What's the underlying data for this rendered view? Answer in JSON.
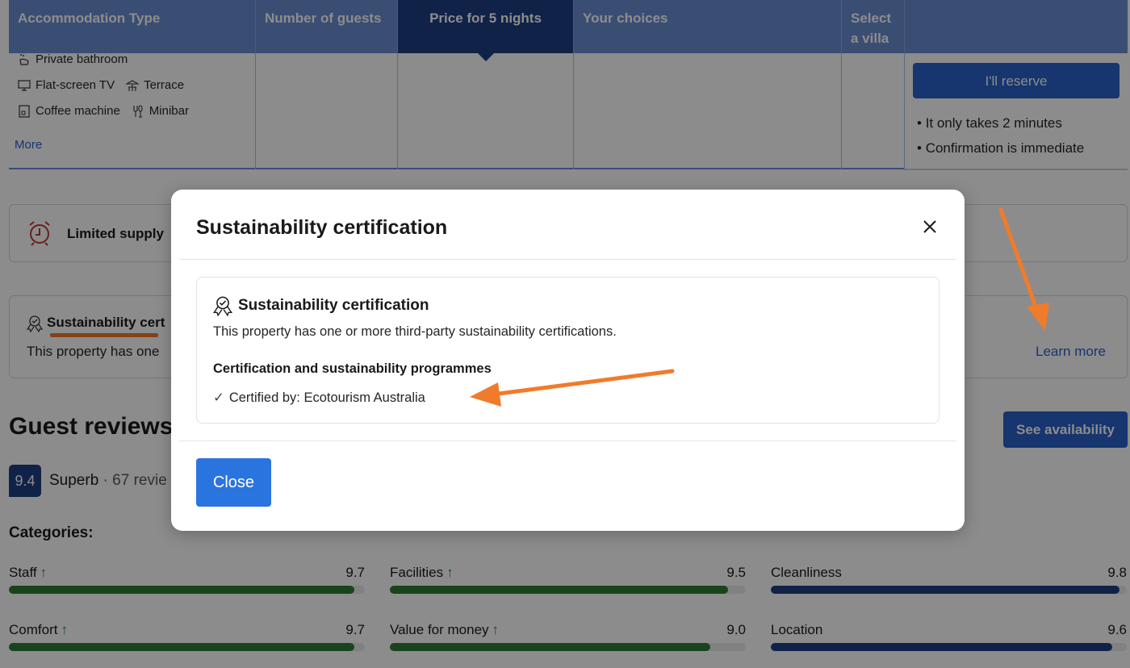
{
  "table": {
    "headers": [
      {
        "label": "Accommodation Type"
      },
      {
        "label": "Number of guests"
      },
      {
        "label": "Price for 5 nights"
      },
      {
        "label": "Your choices"
      },
      {
        "label": "Select a villa"
      },
      {
        "label": ""
      }
    ],
    "amenities": [
      {
        "label": "Private bathroom",
        "icon": "bathroom-icon"
      },
      {
        "label": "Flat-screen TV",
        "icon": "tv-icon"
      },
      {
        "label": "Terrace",
        "icon": "terrace-icon"
      },
      {
        "label": "Coffee machine",
        "icon": "coffee-machine-icon"
      },
      {
        "label": "Minibar",
        "icon": "minibar-icon"
      }
    ],
    "more_link": "More",
    "reserve_button": "I'll reserve",
    "reserve_notes": [
      "It only takes 2 minutes",
      "Confirmation is immediate"
    ]
  },
  "limited_supply": {
    "label": "Limited supply"
  },
  "sustainability_box": {
    "title": "Sustainability cert",
    "description": "This property has one",
    "learn_more": "Learn more"
  },
  "reviews": {
    "title": "Guest reviews",
    "see_availability": "See availability",
    "score": "9.4",
    "rating_label": "Superb",
    "separator": " · ",
    "review_count": "67 revie",
    "categories_title": "Categories:",
    "categories": [
      {
        "name": "Staff",
        "score": 9.7,
        "score_text": "9.7",
        "trend_up": true,
        "color": "#2e7a36"
      },
      {
        "name": "Facilities",
        "score": 9.5,
        "score_text": "9.5",
        "trend_up": true,
        "color": "#2e7a36"
      },
      {
        "name": "Cleanliness",
        "score": 9.8,
        "score_text": "9.8",
        "trend_up": false,
        "color": "#1f3f86"
      },
      {
        "name": "Comfort",
        "score": 9.7,
        "score_text": "9.7",
        "trend_up": true,
        "color": "#2e7a36"
      },
      {
        "name": "Value for money",
        "score": 9.0,
        "score_text": "9.0",
        "trend_up": true,
        "color": "#2e7a36"
      },
      {
        "name": "Location",
        "score": 9.6,
        "score_text": "9.6",
        "trend_up": false,
        "color": "#1f3f86"
      }
    ],
    "max_score": 10,
    "trend_glyph": "↑"
  },
  "modal": {
    "title": "Sustainability certification",
    "card_title": "Sustainability certification",
    "card_description": "This property has one or more third-party sustainability certifications.",
    "programmes_heading": "Certification and sustainability programmes",
    "check_glyph": "✓",
    "certification": "Certified by: Ecotourism Australia",
    "close_button": "Close"
  },
  "colors": {
    "brand_blue": "#2a62c9",
    "dark_blue": "#1f3f86",
    "annotation_orange": "#f07b2b",
    "positive_green": "#2e7a36"
  }
}
